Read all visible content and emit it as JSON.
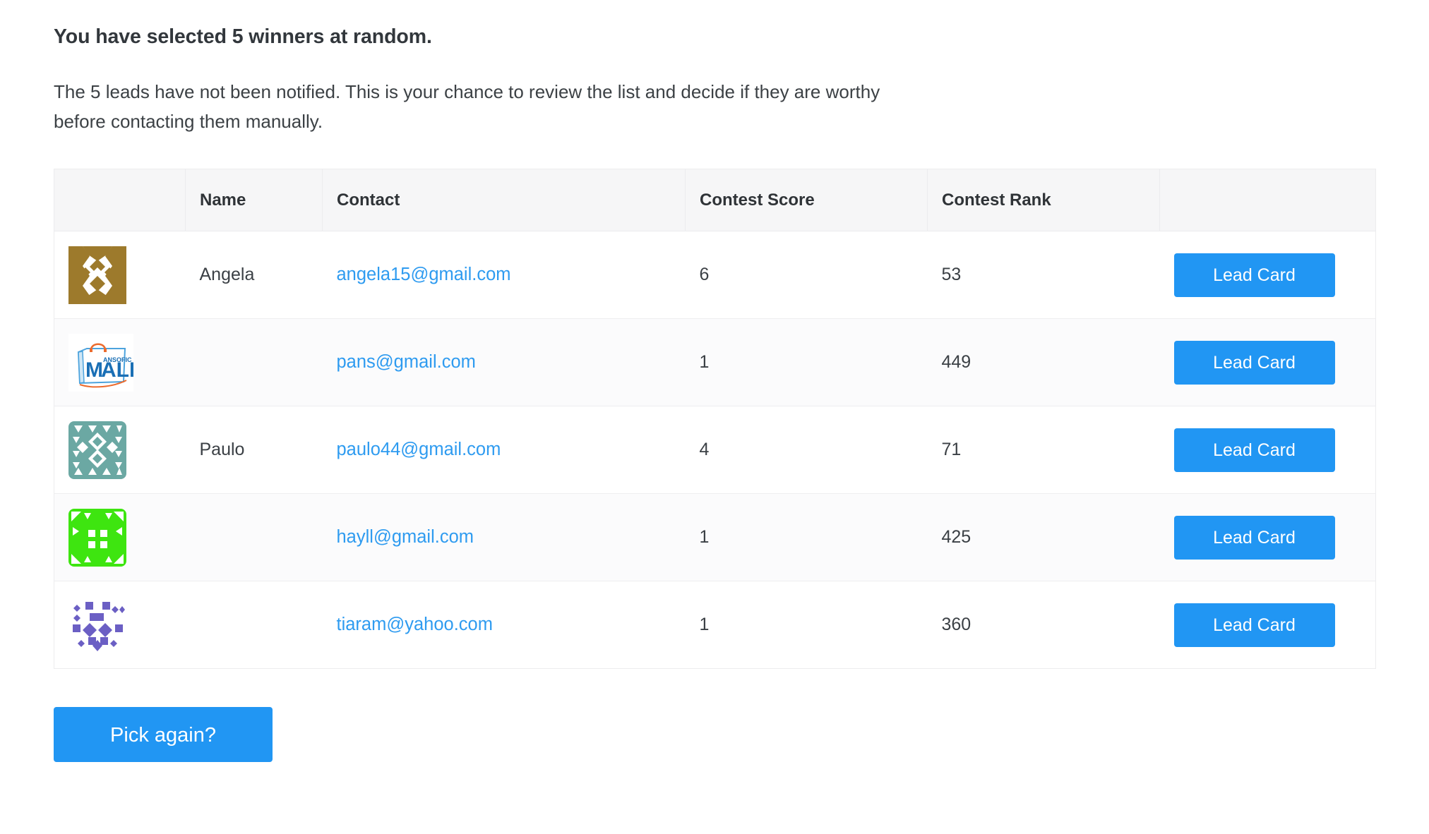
{
  "headline": "You have selected 5 winners at random.",
  "lede": "The 5 leads have not been notified. This is your chance to review the list and decide if they are worthy before contacting them manually.",
  "colors": {
    "accent_blue": "#2196f3",
    "link_blue": "#2e9bf0",
    "header_bg": "#f6f6f7",
    "row_alt_bg": "#fbfbfc",
    "border": "#ececee",
    "text": "#3b4045"
  },
  "table": {
    "headers": {
      "avatar": "",
      "name": "Name",
      "contact": "Contact",
      "score": "Contest Score",
      "rank": "Contest Rank",
      "action": ""
    },
    "rows": [
      {
        "avatar_type": "identicon",
        "avatar_color": "#9d7a2c",
        "avatar_name": "identicon-gold",
        "name": "Angela",
        "contact": "angela15@gmail.com",
        "score": "6",
        "rank": "53",
        "action_label": "Lead Card"
      },
      {
        "avatar_type": "logo",
        "avatar_color": "#1a7bc4",
        "avatar_name": "pansofic-mall-logo",
        "logo_text_top": "ANSOFIC",
        "logo_text_main": "MALL",
        "name": "",
        "contact": "pans@gmail.com",
        "score": "1",
        "rank": "449",
        "action_label": "Lead Card"
      },
      {
        "avatar_type": "identicon",
        "avatar_color": "#6ba8a3",
        "avatar_name": "identicon-teal",
        "name": "Paulo",
        "contact": "paulo44@gmail.com",
        "score": "4",
        "rank": "71",
        "action_label": "Lead Card"
      },
      {
        "avatar_type": "identicon",
        "avatar_color": "#3ee510",
        "avatar_name": "identicon-green",
        "name": "",
        "contact": "hayll@gmail.com",
        "score": "1",
        "rank": "425",
        "action_label": "Lead Card"
      },
      {
        "avatar_type": "identicon",
        "avatar_color": "#6b5fc4",
        "avatar_name": "identicon-purple",
        "name": "",
        "contact": "tiaram@yahoo.com",
        "score": "1",
        "rank": "360",
        "action_label": "Lead Card"
      }
    ]
  },
  "pick_again_label": "Pick again?"
}
